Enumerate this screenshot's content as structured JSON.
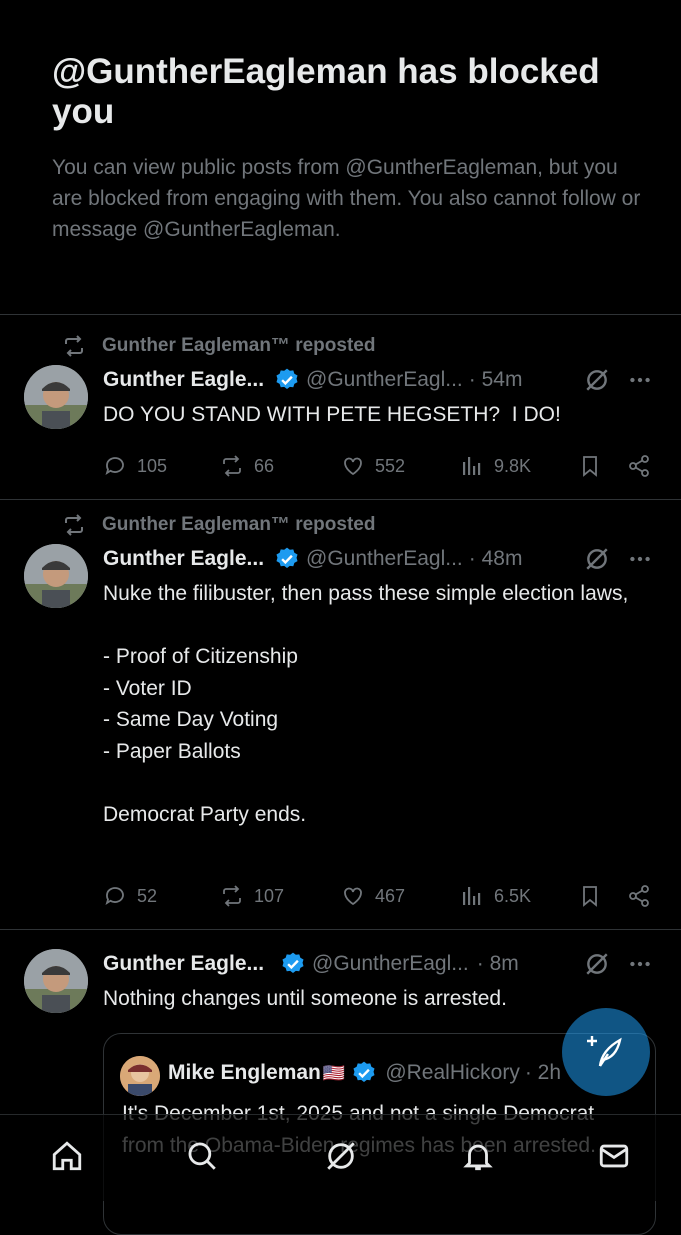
{
  "blocked": {
    "title": "@GuntherEagleman has blocked you",
    "description": "You can view public posts from @GuntherEagleman, but you are blocked from engaging with them. You also cannot follow or message @GuntherEagleman."
  },
  "tweets": [
    {
      "repost_label": "Gunther Eagleman™ reposted",
      "name": "Gunther Eagle...",
      "handle": "@GuntherEagl...",
      "time": "· 54m",
      "text": "DO YOU STAND WITH PETE HEGSETH?  I DO!",
      "replies": "105",
      "reposts": "66",
      "likes": "552",
      "views": "9.8K"
    },
    {
      "repost_label": "Gunther Eagleman™ reposted",
      "name": "Gunther Eagle...",
      "handle": "@GuntherEagl...",
      "time": "· 48m",
      "text": "Nuke the filibuster, then pass these simple election laws,\n\n- Proof of Citizenship\n- Voter ID\n- Same Day Voting\n- Paper Ballots\n\nDemocrat Party ends.",
      "replies": "52",
      "reposts": "107",
      "likes": "467",
      "views": "6.5K"
    },
    {
      "name": "Gunther Eagle...",
      "handle": "@GuntherEagl...",
      "time": "· 8m",
      "text": "Nothing changes until someone is arrested.",
      "quote": {
        "name": "Mike Engleman",
        "flag": "🇺🇸",
        "handle": "@RealHickory",
        "time": "· 2h",
        "text": "It's December 1st, 2025 and not a single Democrat from the Obama-Biden regimes has been arrested."
      }
    }
  ],
  "colors": {
    "accent": "#1d9bf0",
    "muted": "#71767b",
    "text": "#e7e9ea",
    "divider": "#2f3336"
  },
  "icons": [
    "repost-icon",
    "verified-icon",
    "grok-icon",
    "more-icon",
    "reply-icon",
    "like-icon",
    "views-icon",
    "bookmark-icon",
    "share-icon",
    "home-icon",
    "search-icon",
    "grok-nav-icon",
    "notifications-icon",
    "messages-icon",
    "compose-icon"
  ]
}
